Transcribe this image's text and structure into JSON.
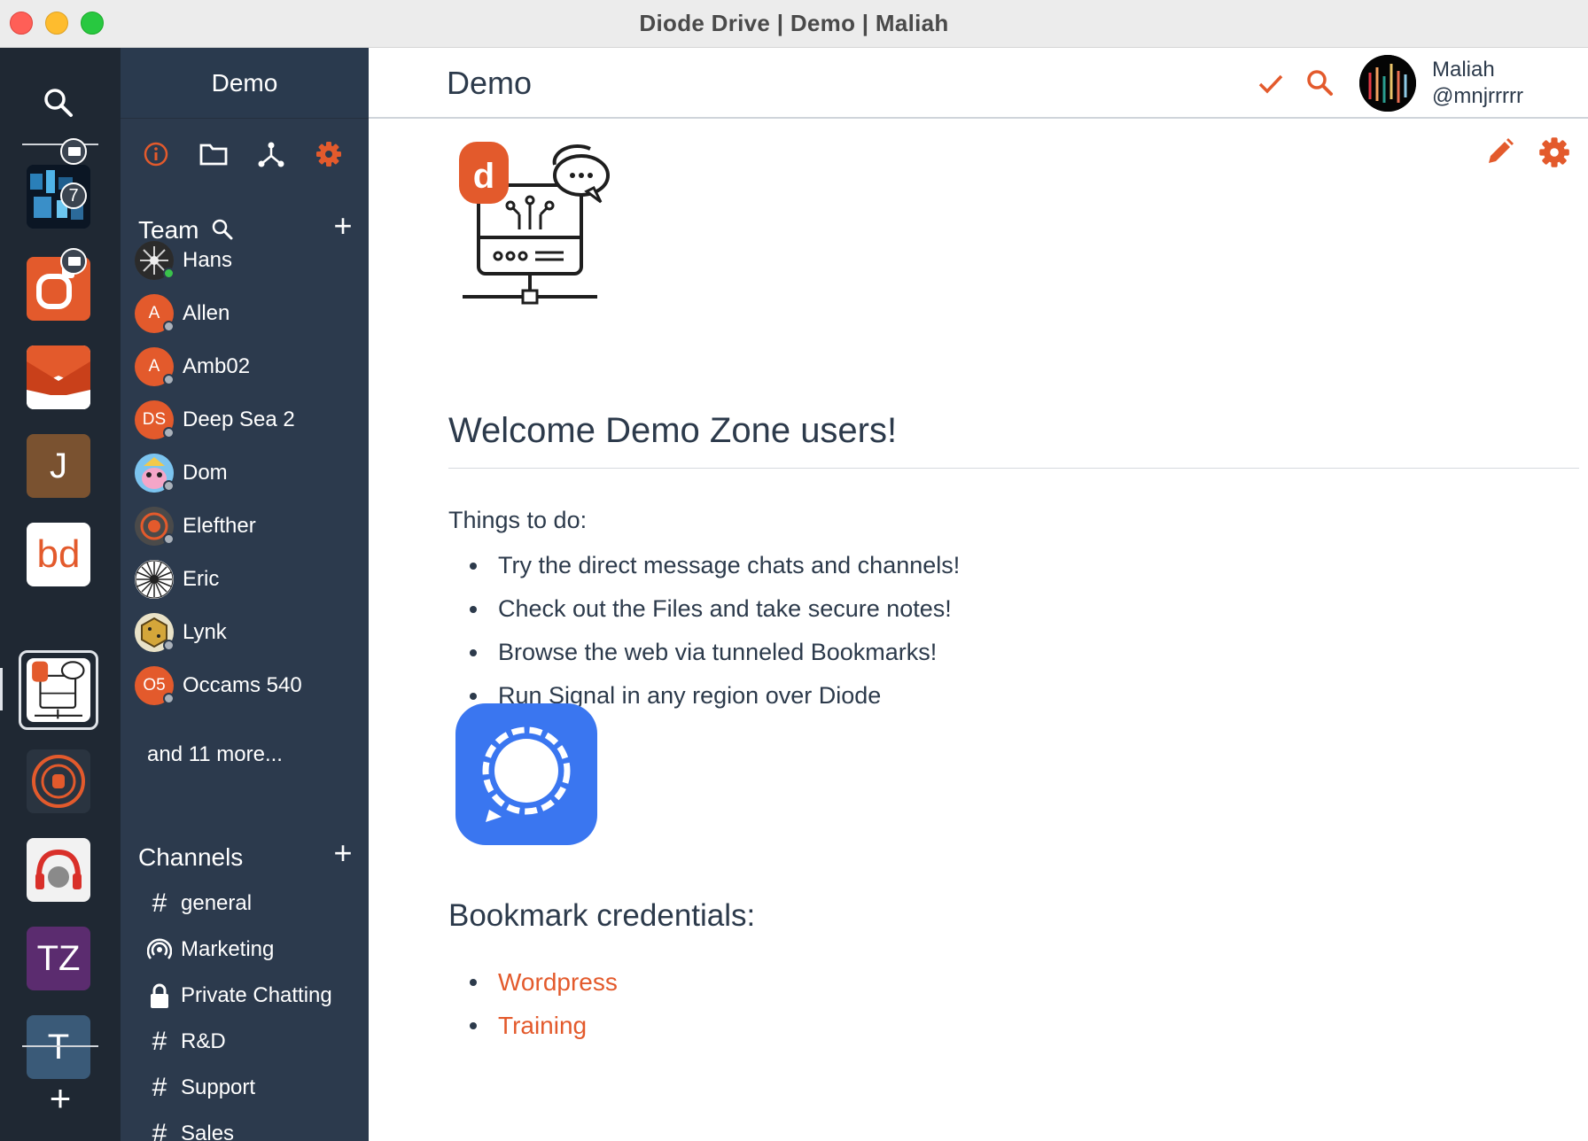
{
  "window": {
    "title": "Diode Drive | Demo | Maliah"
  },
  "rail": {
    "zones": [
      {
        "name": "zone-1",
        "badge": "7",
        "has_folder": true
      },
      {
        "name": "zone-2",
        "has_folder": true
      },
      {
        "name": "zone-3"
      },
      {
        "name": "zone-4",
        "letter": "J",
        "color": "#7a5230"
      },
      {
        "name": "zone-5"
      },
      {
        "name": "zone-6-demo",
        "active": true
      },
      {
        "name": "zone-7"
      },
      {
        "name": "zone-8"
      },
      {
        "name": "zone-9",
        "letter": "TZ",
        "color": "#5b2c6f"
      },
      {
        "name": "zone-10",
        "letter": "T",
        "color": "#3a5a78"
      }
    ]
  },
  "sidebar": {
    "title": "Demo",
    "team": {
      "label": "Team",
      "members": [
        {
          "name": "Hans",
          "initials": "",
          "status": "online"
        },
        {
          "name": "Allen",
          "initials": "A",
          "status": "offline"
        },
        {
          "name": "Amb02",
          "initials": "A",
          "status": "offline"
        },
        {
          "name": "Deep Sea 2",
          "initials": "DS",
          "status": "offline"
        },
        {
          "name": "Dom",
          "initials": "",
          "status": "offline"
        },
        {
          "name": "Elefther",
          "initials": "",
          "status": "offline"
        },
        {
          "name": "Eric",
          "initials": "",
          "status": "offline"
        },
        {
          "name": "Lynk",
          "initials": "",
          "status": "offline"
        },
        {
          "name": "Occams 540",
          "initials": "O5",
          "status": "offline"
        }
      ],
      "more": "and 11 more..."
    },
    "channels": {
      "label": "Channels",
      "items": [
        {
          "name": "general",
          "icon": "hash-icon"
        },
        {
          "name": "Marketing",
          "icon": "broadcast-icon"
        },
        {
          "name": "Private Chatting",
          "icon": "lock-icon"
        },
        {
          "name": "R&D",
          "icon": "hash-icon"
        },
        {
          "name": "Support",
          "icon": "hash-icon"
        },
        {
          "name": "Sales",
          "icon": "hash-icon"
        }
      ]
    }
  },
  "main": {
    "title": "Demo",
    "user": {
      "name": "Maliah",
      "handle": "@mnjrrrrr"
    },
    "welcome": "Welcome Demo Zone users!",
    "things_label": "Things to do:",
    "todos": [
      "Try the direct message chats and channels!",
      "Check out the Files and take secure notes!",
      "Browse the web via tunneled Bookmarks!",
      "Run Signal in any region over Diode"
    ],
    "bookmark_heading": "Bookmark credentials:",
    "bookmarks": [
      "Wordpress",
      "Training"
    ]
  },
  "colors": {
    "accent": "#e35a2c",
    "sidebar_bg": "#2c3a4d",
    "rail_bg": "#1f2833",
    "signal_blue": "#3a76f0"
  }
}
